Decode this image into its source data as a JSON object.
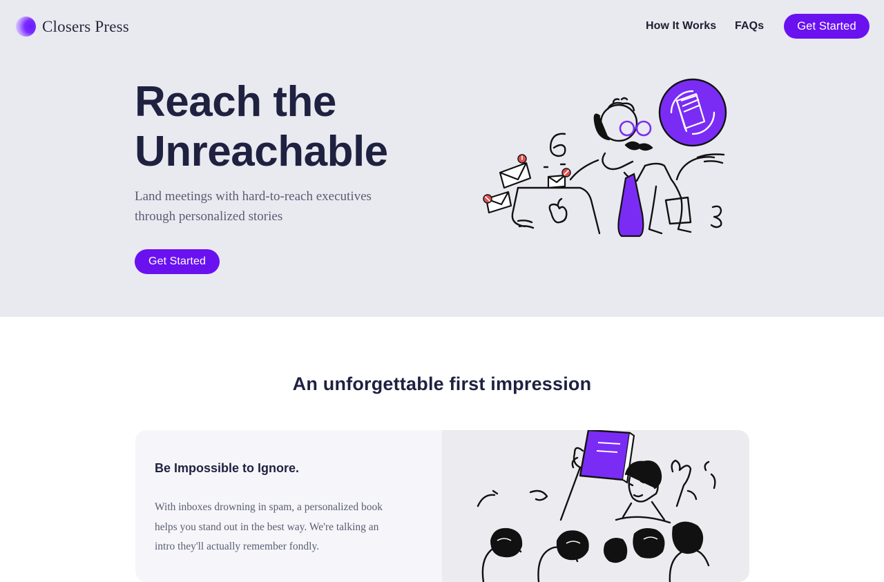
{
  "nav": {
    "brand_name": "Closers Press",
    "links": [
      {
        "label": "How It Works"
      },
      {
        "label": "FAQs"
      }
    ],
    "cta_label": "Get Started"
  },
  "hero": {
    "title_line1": "Reach the",
    "title_line2": "Unreachable",
    "subtitle_line1": "Land meetings with hard-to-reach executives",
    "subtitle_line2": "through personalized stories",
    "cta_label": "Get Started"
  },
  "section": {
    "title": "An unforgettable first impression"
  },
  "card": {
    "title": "Be Impossible to Ignore.",
    "body_line1": "With inboxes drowning in spam, a personalized book",
    "body_line2": "helps you stand out in the best way. We're talking an",
    "body_line3": "intro they'll actually remember fondly."
  },
  "colors": {
    "accent": "#6a11f0",
    "hero_bg": "#e9e9f0",
    "heading": "#1f2140",
    "body_text": "#5a5d72",
    "alert_red": "#e0504f"
  },
  "icons": [
    "brand-logo-icon",
    "envelope-icon",
    "book-icon"
  ]
}
